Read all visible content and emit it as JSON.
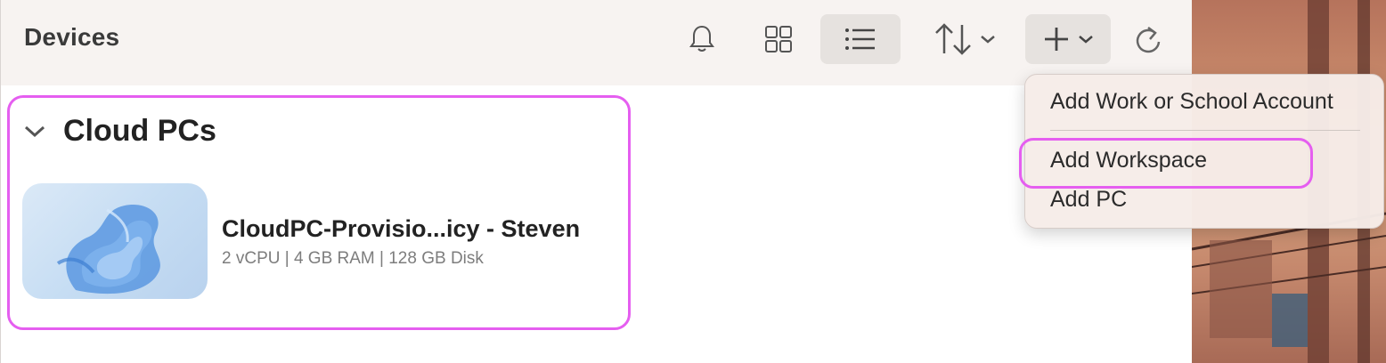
{
  "toolbar": {
    "title": "Devices",
    "icons": [
      "bell-icon",
      "grid-view-icon",
      "list-view-icon",
      "sort-icon",
      "chevron-down-icon",
      "plus-icon",
      "chevron-down-icon",
      "refresh-icon"
    ],
    "active_view": "list"
  },
  "group": {
    "title": "Cloud PCs",
    "expanded": true
  },
  "pc": {
    "name": "CloudPC-Provisio...icy - Steven",
    "specs": "2 vCPU | 4 GB RAM | 128 GB Disk"
  },
  "add_menu": {
    "items": [
      "Add Work or School Account",
      "Add Workspace",
      "Add PC"
    ],
    "highlighted": "Add Workspace"
  },
  "colors": {
    "highlight": "#e55ef0",
    "toolbar_bg": "#f7f3f1",
    "menu_bg": "#f6ece8"
  }
}
